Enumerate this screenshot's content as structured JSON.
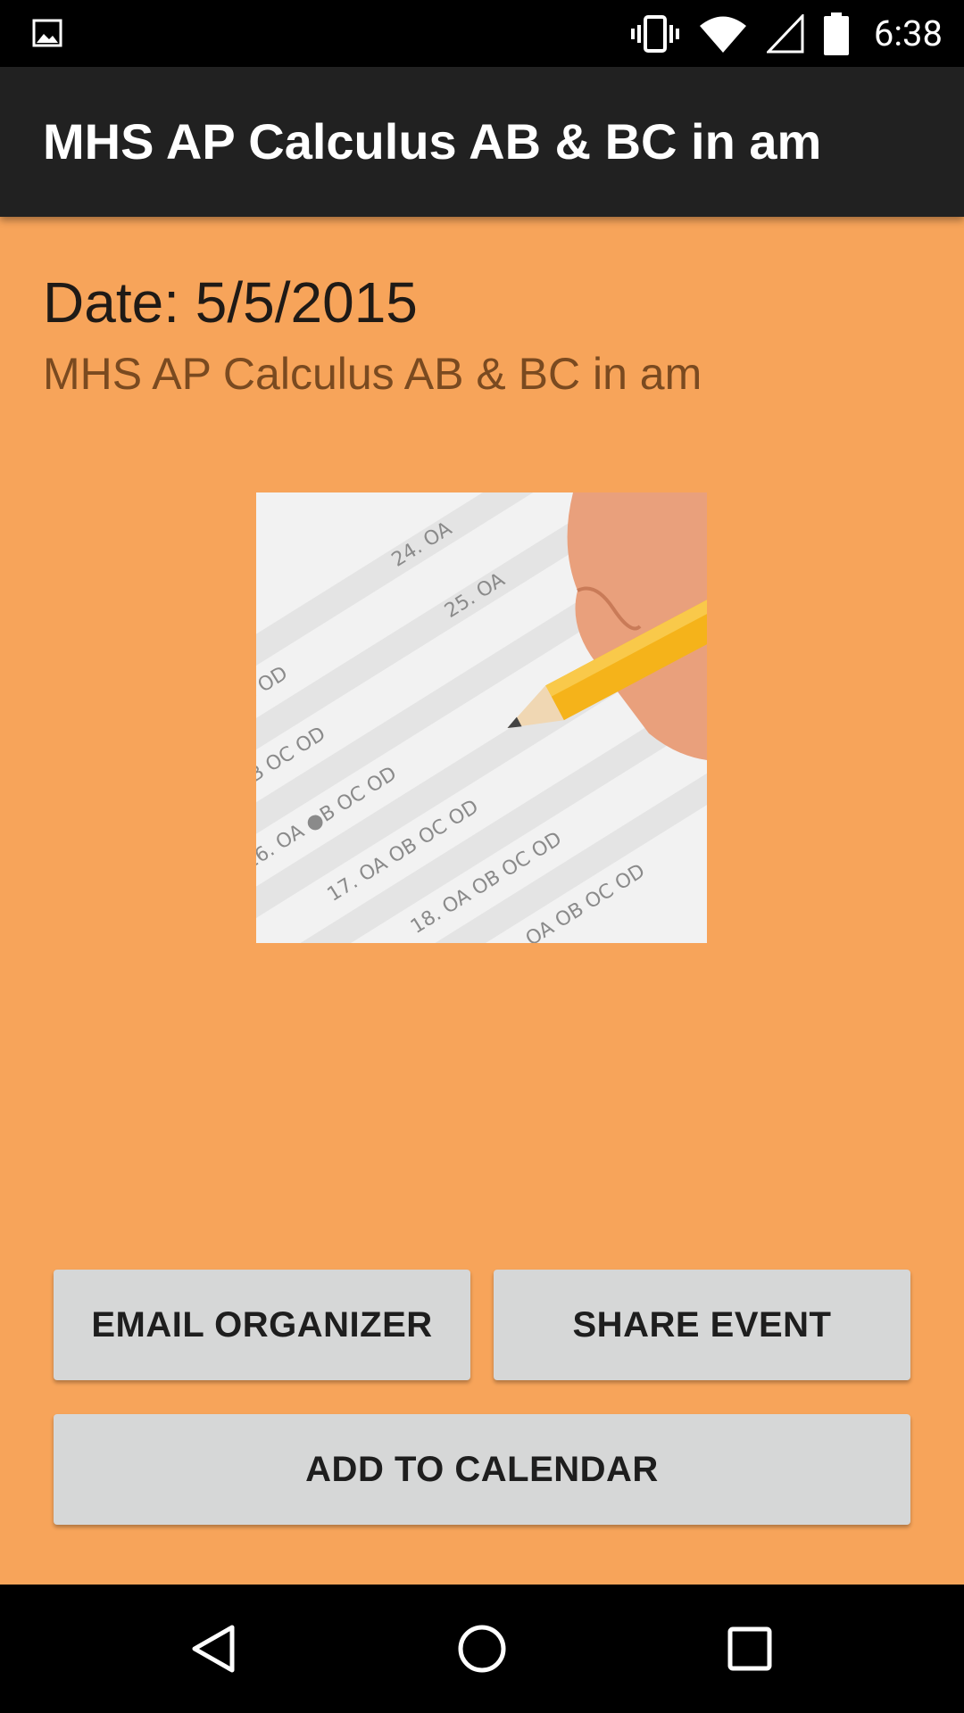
{
  "status_bar": {
    "time": "6:38",
    "icons": [
      "image-notification-icon",
      "vibrate-icon",
      "wifi-icon",
      "cell-signal-icon",
      "battery-icon"
    ]
  },
  "action_bar": {
    "title": "MHS AP Calculus AB & BC in am"
  },
  "event": {
    "date_text": "Date: 5/5/2015",
    "subtitle": "MHS AP Calculus AB & BC in am",
    "image_name": "test-answer-sheet-image"
  },
  "buttons": {
    "email_organizer": "EMAIL ORGANIZER",
    "share_event": "SHARE EVENT",
    "add_to_calendar": "ADD TO CALENDAR"
  },
  "nav_bar": {
    "icons": [
      "back-icon",
      "home-icon",
      "recents-icon"
    ]
  },
  "colors": {
    "background": "#f7a45a",
    "action_bar": "#212121",
    "button": "#d6d7d7",
    "subtitle_text": "#7a4a20"
  }
}
